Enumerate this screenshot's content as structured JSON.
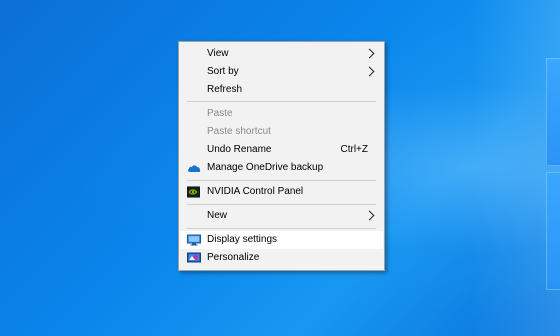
{
  "menu": {
    "items": [
      {
        "label": "View",
        "submenu": true,
        "disabled": false
      },
      {
        "label": "Sort by",
        "submenu": true,
        "disabled": false
      },
      {
        "label": "Refresh",
        "disabled": false
      },
      {
        "label": "Paste",
        "disabled": true
      },
      {
        "label": "Paste shortcut",
        "disabled": true
      },
      {
        "label": "Undo Rename",
        "shortcut": "Ctrl+Z",
        "disabled": false
      },
      {
        "label": "Manage OneDrive backup",
        "icon": "onedrive-icon",
        "disabled": false
      },
      {
        "label": "NVIDIA Control Panel",
        "icon": "nvidia-icon",
        "disabled": false
      },
      {
        "label": "New",
        "submenu": true,
        "disabled": false
      },
      {
        "label": "Display settings",
        "icon": "display-settings-icon",
        "disabled": false,
        "highlighted": true
      },
      {
        "label": "Personalize",
        "icon": "personalize-icon",
        "disabled": false
      }
    ]
  },
  "colors": {
    "desktop": "#0a84e8",
    "menu_bg": "#f2f2f2",
    "highlight": "#ffffff",
    "disabled_text": "#8a8a8a"
  }
}
